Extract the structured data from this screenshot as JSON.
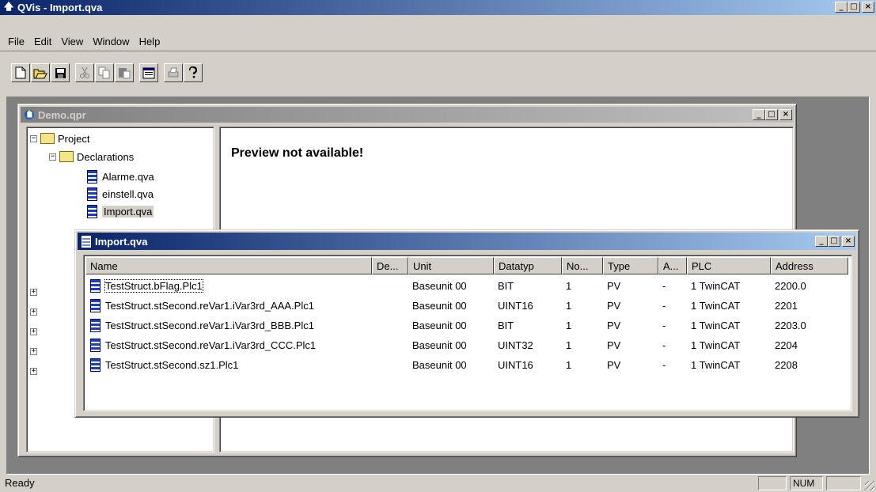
{
  "app": {
    "title": "QVis - Import.qva",
    "minimize": "_",
    "maximize": "□",
    "close": "×"
  },
  "menu": [
    "File",
    "Edit",
    "View",
    "Window",
    "Help"
  ],
  "toolbar": {
    "buttons": [
      "new-icon",
      "open-icon",
      "save-icon",
      "cut-icon",
      "copy-icon",
      "paste-icon",
      "properties-icon",
      "print-icon",
      "help-icon"
    ]
  },
  "demo": {
    "title": "Demo.qpr",
    "preview_text": "Preview not available!",
    "tree": {
      "project": "Project",
      "declarations": "Declarations",
      "files": [
        "Alarme.qva",
        "einstell.qva",
        "Import.qva"
      ]
    }
  },
  "import": {
    "title": "Import.qva",
    "columns": [
      "Name",
      "De...",
      "Unit",
      "Datatyp",
      "No...",
      "Type",
      "A...",
      "PLC",
      "Address"
    ],
    "rows": [
      {
        "name": "TestStruct.bFlag.Plc1",
        "de": "",
        "unit": "Baseunit 00",
        "datatyp": "BIT",
        "no": "1",
        "type": "PV",
        "a": "-",
        "plc": "1 TwinCAT",
        "address": "2200.0"
      },
      {
        "name": "TestStruct.stSecond.reVar1.iVar3rd_AAA.Plc1",
        "de": "",
        "unit": "Baseunit 00",
        "datatyp": "UINT16",
        "no": "1",
        "type": "PV",
        "a": "-",
        "plc": "1 TwinCAT",
        "address": "2201"
      },
      {
        "name": "TestStruct.stSecond.reVar1.iVar3rd_BBB.Plc1",
        "de": "",
        "unit": "Baseunit 00",
        "datatyp": "BIT",
        "no": "1",
        "type": "PV",
        "a": "-",
        "plc": "1 TwinCAT",
        "address": "2203.0"
      },
      {
        "name": "TestStruct.stSecond.reVar1.iVar3rd_CCC.Plc1",
        "de": "",
        "unit": "Baseunit 00",
        "datatyp": "UINT32",
        "no": "1",
        "type": "PV",
        "a": "-",
        "plc": "1 TwinCAT",
        "address": "2204"
      },
      {
        "name": "TestStruct.stSecond.sz1.Plc1",
        "de": "",
        "unit": "Baseunit 00",
        "datatyp": "UINT16",
        "no": "1",
        "type": "PV",
        "a": "-",
        "plc": "1 TwinCAT",
        "address": "2208"
      }
    ]
  },
  "status": {
    "text": "Ready",
    "num": "NUM"
  }
}
